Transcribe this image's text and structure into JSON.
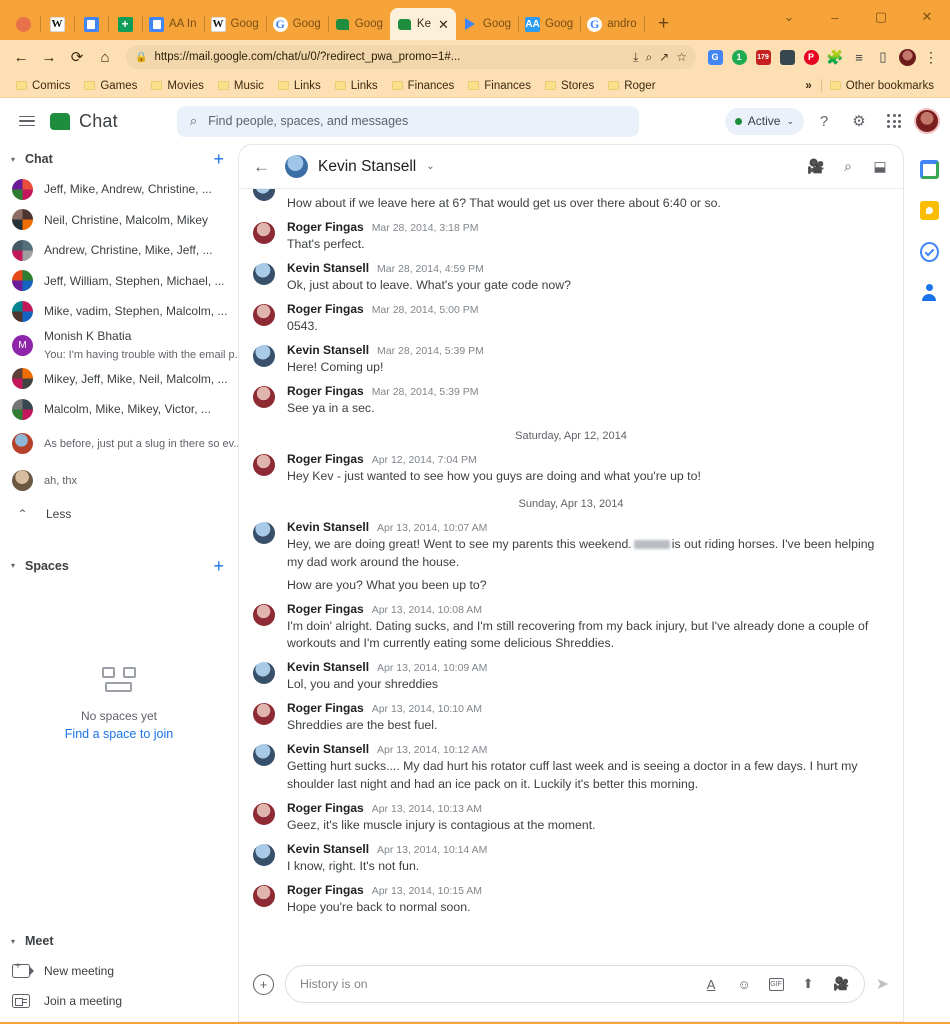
{
  "browser": {
    "tabs": [
      {
        "label": "",
        "icon": "asana-icon",
        "pinned": true
      },
      {
        "label": "",
        "icon": "wikipedia-icon",
        "pinned": true
      },
      {
        "label": "",
        "icon": "google-docs-icon",
        "pinned": true
      },
      {
        "label": "",
        "icon": "google-sheets-icon",
        "pinned": true
      },
      {
        "label": "AA In",
        "icon": "google-docs-icon",
        "pinned": false
      },
      {
        "label": "Goog",
        "icon": "wikipedia-icon",
        "pinned": false
      },
      {
        "label": "Goog",
        "icon": "google-icon",
        "pinned": false
      },
      {
        "label": "Goog",
        "icon": "google-chat-icon",
        "pinned": false
      },
      {
        "label": "Ke",
        "icon": "google-chat-icon",
        "pinned": false,
        "active": true
      },
      {
        "label": "Goog",
        "icon": "google-play-icon",
        "pinned": false
      },
      {
        "label": "Goog",
        "icon": "play-store-icon",
        "pinned": false
      },
      {
        "label": "andro",
        "icon": "google-icon",
        "pinned": false
      }
    ],
    "new_tab_label": "+",
    "window_controls": {
      "expand": "⌄",
      "minimize": "–",
      "maximize": "▢",
      "close": "✕"
    },
    "nav": {
      "back": "←",
      "forward": "→",
      "reload": "⟳",
      "home": "⌂"
    },
    "address_bar": {
      "lock_icon": "lock-icon",
      "url": "https://mail.google.com/chat/u/0/?redirect_pwa_promo=1#...",
      "install_icon": "install-icon",
      "zoom_icon": "zoom-icon",
      "share_icon": "share-icon",
      "bookmark_icon": "star-icon"
    },
    "extensions": [
      {
        "name": "google-translate-icon",
        "label": "G",
        "color": "#4285f4"
      },
      {
        "name": "one-password-icon",
        "label": "1",
        "color": "#1eab52"
      },
      {
        "name": "calendar-badge-icon",
        "label": "179",
        "color": "#c5221f"
      },
      {
        "name": "image-extension-icon",
        "label": "",
        "color": "#37474f"
      },
      {
        "name": "pinterest-icon",
        "label": "P",
        "color": "#e60023"
      },
      {
        "name": "puzzle-extensions-icon",
        "label": "",
        "color": "#3c4043"
      },
      {
        "name": "reading-list-icon",
        "label": "",
        "color": "#3c4043"
      },
      {
        "name": "side-panel-icon",
        "label": "",
        "color": "#3c4043"
      }
    ],
    "profile_icon": "profile-avatar",
    "menu_icon": "three-dot-menu-icon",
    "bookmarks": [
      "Comics",
      "Games",
      "Movies",
      "Music",
      "Links",
      "Links",
      "Finances",
      "Finances",
      "Stores",
      "Roger"
    ],
    "bookmarks_overflow": "»",
    "other_bookmarks": "Other bookmarks"
  },
  "app_header": {
    "menu_icon": "hamburger-menu-icon",
    "brand": "Chat",
    "brand_icon": "google-chat-logo",
    "search_placeholder": "Find people, spaces, and messages",
    "search_icon": "search-icon",
    "status": "Active",
    "status_color": "#1e8e3e",
    "status_caret": "⌄",
    "help_icon": "help-icon",
    "settings_icon": "gear-icon",
    "apps_icon": "apps-grid-icon",
    "account_icon": "account-avatar"
  },
  "sidebar": {
    "chat_section": {
      "title": "Chat",
      "caret": "▾",
      "add_label": "+"
    },
    "chats": [
      {
        "name": "Jeff, Mike, Andrew, Christine, ...",
        "preview": "",
        "avatar": "group-avatar"
      },
      {
        "name": "Neil, Christine, Malcolm, Mikey",
        "preview": "",
        "avatar": "group-avatar"
      },
      {
        "name": "Andrew, Christine, Mike, Jeff, ...",
        "preview": "",
        "avatar": "group-avatar"
      },
      {
        "name": "Jeff, William, Stephen, Michael, ...",
        "preview": "",
        "avatar": "group-avatar"
      },
      {
        "name": "Mike, vadim, Stephen, Malcolm, ...",
        "preview": "",
        "avatar": "group-avatar"
      },
      {
        "name": "Monish K Bhatia",
        "preview": "You: I'm having trouble with the email p...",
        "avatar": "monogram-avatar-m"
      },
      {
        "name": "Mikey, Jeff, Mike, Neil, Malcolm, ...",
        "preview": "",
        "avatar": "group-avatar"
      },
      {
        "name": "Malcolm, Mike, Mikey, Victor, ...",
        "preview": "",
        "avatar": "group-avatar"
      },
      {
        "name": "",
        "preview": "As before, just put a slug in there so ev...",
        "avatar": "person-avatar",
        "redacted": true
      },
      {
        "name": "",
        "preview": "ah, thx",
        "avatar": "person-avatar",
        "redacted": true
      }
    ],
    "less_label": "Less",
    "less_caret": "⌃",
    "spaces_section": {
      "title": "Spaces",
      "caret": "▾",
      "add_label": "+"
    },
    "spaces_empty": {
      "icon": "spaces-empty-icon",
      "title": "No spaces yet",
      "link": "Find a space to join"
    },
    "meet_section": {
      "title": "Meet",
      "caret": "▾"
    },
    "meet_items": [
      {
        "label": "New meeting",
        "icon": "new-meeting-icon"
      },
      {
        "label": "Join a meeting",
        "icon": "join-meeting-icon"
      }
    ]
  },
  "conversation": {
    "back_icon": "back-arrow-icon",
    "title": "Kevin Stansell",
    "title_caret": "⌄",
    "avatar": "kevin-avatar",
    "actions": [
      {
        "name": "video-call-icon",
        "glyph": "▣"
      },
      {
        "name": "search-in-conversation-icon",
        "glyph": "search"
      },
      {
        "name": "open-in-new-window-icon",
        "glyph": "▣"
      }
    ],
    "messages": [
      {
        "type": "orphan",
        "sender": "Kevin Stansell",
        "avatar": "kevin",
        "text": "How about if we leave here at 6?  That would get us over there about 6:40 or so."
      },
      {
        "type": "message",
        "sender": "Roger Fingas",
        "avatar": "roger",
        "time": "Mar 28, 2014, 3:18 PM",
        "text": "That's perfect."
      },
      {
        "type": "message",
        "sender": "Kevin Stansell",
        "avatar": "kevin",
        "time": "Mar 28, 2014, 4:59 PM",
        "text": "Ok, just about to leave. What's your gate code now?"
      },
      {
        "type": "message",
        "sender": "Roger Fingas",
        "avatar": "roger",
        "time": "Mar 28, 2014, 5:00 PM",
        "text": "0543."
      },
      {
        "type": "message",
        "sender": "Kevin Stansell",
        "avatar": "kevin",
        "time": "Mar 28, 2014, 5:39 PM",
        "text": "Here!  Coming up!"
      },
      {
        "type": "message",
        "sender": "Roger Fingas",
        "avatar": "roger",
        "time": "Mar 28, 2014, 5:39 PM",
        "text": "See ya in a sec."
      },
      {
        "type": "day",
        "label": "Saturday, Apr 12, 2014"
      },
      {
        "type": "message",
        "sender": "Roger Fingas",
        "avatar": "roger",
        "time": "Apr 12, 2014, 7:04 PM",
        "text": "Hey Kev - just wanted to see how you guys are doing and what you're up to!"
      },
      {
        "type": "day",
        "label": "Sunday, Apr 13, 2014"
      },
      {
        "type": "message",
        "sender": "Kevin Stansell",
        "avatar": "kevin",
        "time": "Apr 13, 2014, 10:07 AM",
        "text_pre": "Hey, we are doing great!  Went to see my parents this weekend.",
        "redacted": true,
        "text_post": "is out riding horses. I've been helping my dad work around the house.",
        "text2": "How are you?  What you been up to?"
      },
      {
        "type": "message",
        "sender": "Roger Fingas",
        "avatar": "roger",
        "time": "Apr 13, 2014, 10:08 AM",
        "text": "I'm doin' alright.  Dating sucks, and I'm still recovering from my back injury, but I've already done a couple of workouts and I'm currently eating some delicious Shreddies."
      },
      {
        "type": "message",
        "sender": "Kevin Stansell",
        "avatar": "kevin",
        "time": "Apr 13, 2014, 10:09 AM",
        "text": "Lol, you and your shreddies"
      },
      {
        "type": "message",
        "sender": "Roger Fingas",
        "avatar": "roger",
        "time": "Apr 13, 2014, 10:10 AM",
        "text": "Shreddies are the best fuel."
      },
      {
        "type": "message",
        "sender": "Kevin Stansell",
        "avatar": "kevin",
        "time": "Apr 13, 2014, 10:12 AM",
        "text": "Getting hurt sucks.... My dad hurt his rotator cuff last week and is seeing a doctor in a few days. I hurt my shoulder last night and had an ice pack on it. Luckily it's better this morning."
      },
      {
        "type": "message",
        "sender": "Roger Fingas",
        "avatar": "roger",
        "time": "Apr 13, 2014, 10:13 AM",
        "text": "Geez, it's like muscle injury is contagious at the moment."
      },
      {
        "type": "message",
        "sender": "Kevin Stansell",
        "avatar": "kevin",
        "time": "Apr 13, 2014, 10:14 AM",
        "text": "I know, right. It's not fun."
      },
      {
        "type": "message",
        "sender": "Roger Fingas",
        "avatar": "roger",
        "time": "Apr 13, 2014, 10:15 AM",
        "text": "Hope you're back to normal soon."
      }
    ],
    "composer": {
      "add_icon": "add-attachment-icon",
      "placeholder": "History is on",
      "tools": [
        {
          "name": "format-text-icon",
          "glyph": "A"
        },
        {
          "name": "emoji-icon",
          "glyph": "☺"
        },
        {
          "name": "gif-icon",
          "glyph": "GIF"
        },
        {
          "name": "upload-file-icon",
          "glyph": "⬆"
        },
        {
          "name": "video-meeting-icon",
          "glyph": "▣"
        }
      ],
      "send_icon": "send-icon"
    }
  },
  "right_rail": [
    {
      "name": "calendar-icon"
    },
    {
      "name": "keep-icon"
    },
    {
      "name": "tasks-icon"
    },
    {
      "name": "contacts-icon"
    }
  ]
}
